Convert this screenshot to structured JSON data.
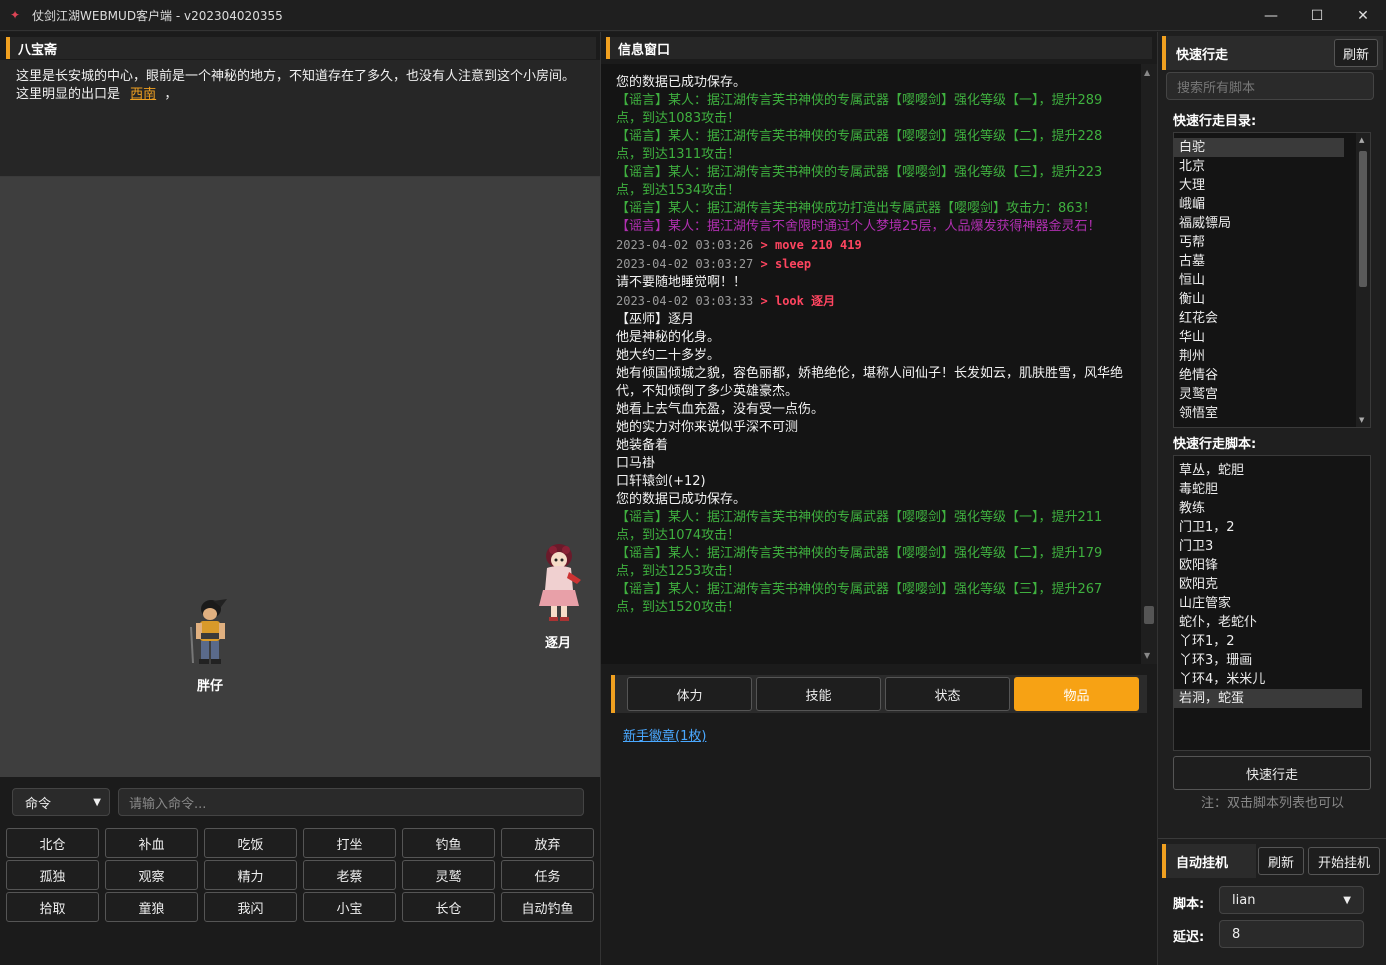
{
  "window": {
    "title": "仗剑江湖WEBMUD客户端 - v202304020355",
    "controls": {
      "minimize": "—",
      "maximize": "☐",
      "close": "✕"
    }
  },
  "room": {
    "name": "八宝斋",
    "desc": "这里是长安城的中心，眼前是一个神秘的地方，不知道存在了多久，也没有人注意到这个小房间。",
    "exit_prefix": "这里明显的出口是",
    "exit": "西南",
    "exit_suffix": "，"
  },
  "scene": {
    "npcs": [
      {
        "name": "胖仔"
      },
      {
        "name": "逐月"
      }
    ]
  },
  "command": {
    "select": "命令",
    "placeholder": "请输入命令..."
  },
  "buttons": [
    "北仓",
    "补血",
    "吃饭",
    "打坐",
    "钓鱼",
    "放弃",
    "孤独",
    "观察",
    "精力",
    "老蔡",
    "灵鹫",
    "任务",
    "拾取",
    "童狼",
    "我闪",
    "小宝",
    "长仓",
    "自动钓鱼"
  ],
  "info": {
    "title": "信息窗口",
    "lines": [
      {
        "t": "w",
        "text": "您的数据已成功保存。"
      },
      {
        "t": "g",
        "text": "【谣言】某人：据江湖传言芙书神侠的专属武器【嘤嘤剑】强化等级【一】，提升289点，到达1083攻击！"
      },
      {
        "t": "g",
        "text": "【谣言】某人：据江湖传言芙书神侠的专属武器【嘤嘤剑】强化等级【二】，提升228点，到达1311攻击！"
      },
      {
        "t": "g",
        "text": "【谣言】某人：据江湖传言芙书神侠的专属武器【嘤嘤剑】强化等级【三】，提升223点，到达1534攻击！"
      },
      {
        "t": "g",
        "text": "【谣言】某人：据江湖传言芙书神侠成功打造出专属武器【嘤嘤剑】攻击力：863！"
      },
      {
        "t": "p",
        "text": "【谣言】某人：据江湖传言不舍限时通过个人梦境25层，人品爆发获得神器金灵石！"
      },
      {
        "t": "cmd",
        "ts": "2023-04-02 03:03:26",
        "text": "move 210 419"
      },
      {
        "t": "cmd",
        "ts": "2023-04-02 03:03:27",
        "text": "sleep"
      },
      {
        "t": "w",
        "text": "请不要随地睡觉啊！！"
      },
      {
        "t": "cmd",
        "ts": "2023-04-02 03:03:33",
        "text": "look 逐月"
      },
      {
        "t": "w",
        "text": "【巫师】逐月"
      },
      {
        "t": "w",
        "text": "他是神秘的化身。"
      },
      {
        "t": "w",
        "text": "她大约二十多岁。"
      },
      {
        "t": "w",
        "text": "她有倾国倾城之貌，容色丽都，娇艳绝伦，堪称人间仙子！长发如云，肌肤胜雪，风华绝代，不知倾倒了多少英雄豪杰。"
      },
      {
        "t": "w",
        "text": "她看上去气血充盈，没有受一点伤。"
      },
      {
        "t": "w",
        "text": "她的实力对你来说似乎深不可测"
      },
      {
        "t": "w",
        "text": "她装备着"
      },
      {
        "t": "w",
        "text": "口马褂"
      },
      {
        "t": "w",
        "text": "口轩辕剑(+12)"
      },
      {
        "t": "w",
        "text": "您的数据已成功保存。"
      },
      {
        "t": "g",
        "text": "【谣言】某人：据江湖传言芙书神侠的专属武器【嘤嘤剑】强化等级【一】，提升211点，到达1074攻击！"
      },
      {
        "t": "g",
        "text": "【谣言】某人：据江湖传言芙书神侠的专属武器【嘤嘤剑】强化等级【二】，提升179点，到达1253攻击！"
      },
      {
        "t": "g",
        "text": "【谣言】某人：据江湖传言芙书神侠的专属武器【嘤嘤剑】强化等级【三】，提升267点，到达1520攻击！"
      }
    ],
    "scroll_position": 0.97
  },
  "tabs": {
    "items": [
      "体力",
      "技能",
      "状态",
      "物品"
    ],
    "active": 3
  },
  "item_link": "新手徽章(1枚)",
  "quick": {
    "title": "快速行走",
    "refresh": "刷新",
    "search_placeholder": "搜索所有脚本",
    "dir_label": "快速行走目录:",
    "dirs": [
      "白驼",
      "北京",
      "大理",
      "峨嵋",
      "福威镖局",
      "丐帮",
      "古墓",
      "恒山",
      "衡山",
      "红花会",
      "华山",
      "荆州",
      "绝情谷",
      "灵鹫宫",
      "领悟室"
    ],
    "script_label": "快速行走脚本:",
    "scripts": [
      "草丛，蛇胆",
      "毒蛇胆",
      "教练",
      "门卫1，2",
      "门卫3",
      "欧阳锋",
      "欧阳克",
      "山庄管家",
      "蛇仆，老蛇仆",
      "丫环1，2",
      "丫环3，珊画",
      "丫环4，米米儿",
      "岩洞，蛇蛋"
    ],
    "go": "快速行走",
    "note": "注：双击脚本列表也可以"
  },
  "auto": {
    "title": "自动挂机",
    "refresh": "刷新",
    "start": "开始挂机",
    "script_label": "脚本:",
    "script_value": "lian",
    "delay_label": "延迟:",
    "delay_value": "8"
  },
  "colors": {
    "accent": "#f0a020",
    "tab_active": "#f7a214",
    "rumor": "#3fb03f",
    "rumor_purple": "#b02fb0",
    "command": "#ff4560",
    "link": "#4aa8ff"
  }
}
